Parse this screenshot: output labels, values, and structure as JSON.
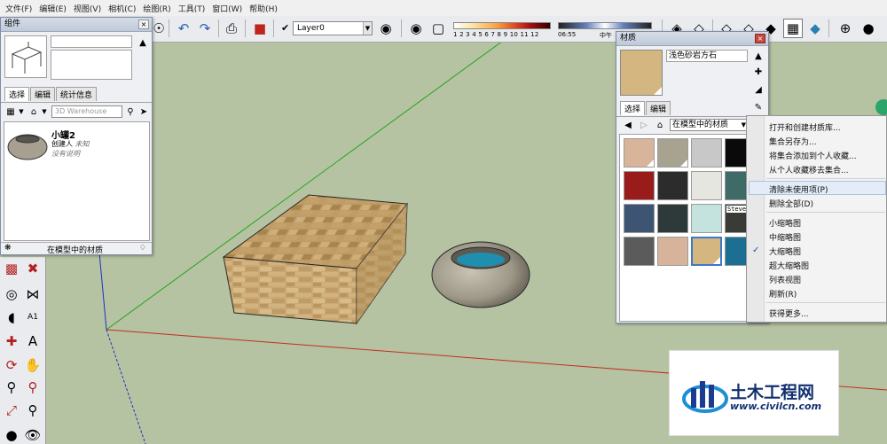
{
  "menu": [
    "文件(F)",
    "编辑(E)",
    "视图(V)",
    "相机(C)",
    "绘图(R)",
    "工具(T)",
    "窗口(W)",
    "帮助(H)"
  ],
  "toolbar": {
    "layer_name": "Layer0",
    "shadow_scale": "1 2 3 4 5 6 7 8 9 10 11 12",
    "time_start": "06:55",
    "time_mid": "中午"
  },
  "components_panel": {
    "title": "组件",
    "tabs": [
      "选择",
      "编辑",
      "统计信息"
    ],
    "search_placeholder": "3D Warehouse",
    "item": {
      "name": "小罐2",
      "creator": "创建人",
      "creator_value": "未知",
      "description": "没有说明"
    },
    "footer": "在模型中的材质"
  },
  "materials_panel": {
    "title": "材质",
    "material_name": "浅色砂岩方石",
    "tabs": [
      "选择",
      "编辑"
    ],
    "collection": "在模型中的材质",
    "swatch_label": "Steve"
  },
  "context_menu": {
    "items": [
      "打开和创建材质库...",
      "集合另存为...",
      "将集合添加到个人收藏...",
      "从个人收藏移去集合...",
      "清除未使用项(P)",
      "删除全部(D)",
      "小缩略图",
      "中缩略图",
      "大缩略图",
      "超大缩略图",
      "列表视图",
      "刷新(R)",
      "获得更多..."
    ],
    "checked": "大缩略图",
    "highlighted": "清除未使用项(P)"
  },
  "swatches": [
    {
      "color": "#d8b49b",
      "corner": true
    },
    {
      "color": "#a8a290",
      "corner": true
    },
    {
      "color": "#c8c8c8",
      "corner": false
    },
    {
      "color": "#0a0a0a",
      "corner": false
    },
    {
      "color": "#9a1c1a",
      "corner": false
    },
    {
      "color": "#2c2c2c",
      "corner": false
    },
    {
      "color": "#e4e6df",
      "corner": false
    },
    {
      "color": "#3e6a67",
      "corner": false
    },
    {
      "color": "#3d5573",
      "corner": false
    },
    {
      "color": "#2e3a3a",
      "corner": false
    },
    {
      "color": "#c4e2de",
      "corner": false
    },
    {
      "color": "#3a3a36",
      "corner": false
    },
    {
      "color": "#5b5b5b",
      "corner": false
    },
    {
      "color": "#d7b39c",
      "corner": false
    },
    {
      "color": "#d4b680",
      "corner": true
    },
    {
      "color": "#1c6f93",
      "corner": false
    }
  ],
  "watermark": {
    "brand": "土木工程网",
    "url": "www.civilcn.com"
  },
  "colors": {
    "ground": "#b6c3a2",
    "panel_bg": "#eef0f3",
    "accent_blue": "#3d78c9",
    "axis_red": "#c0301c",
    "axis_green": "#24a41a",
    "axis_blue": "#1a2fc8"
  }
}
